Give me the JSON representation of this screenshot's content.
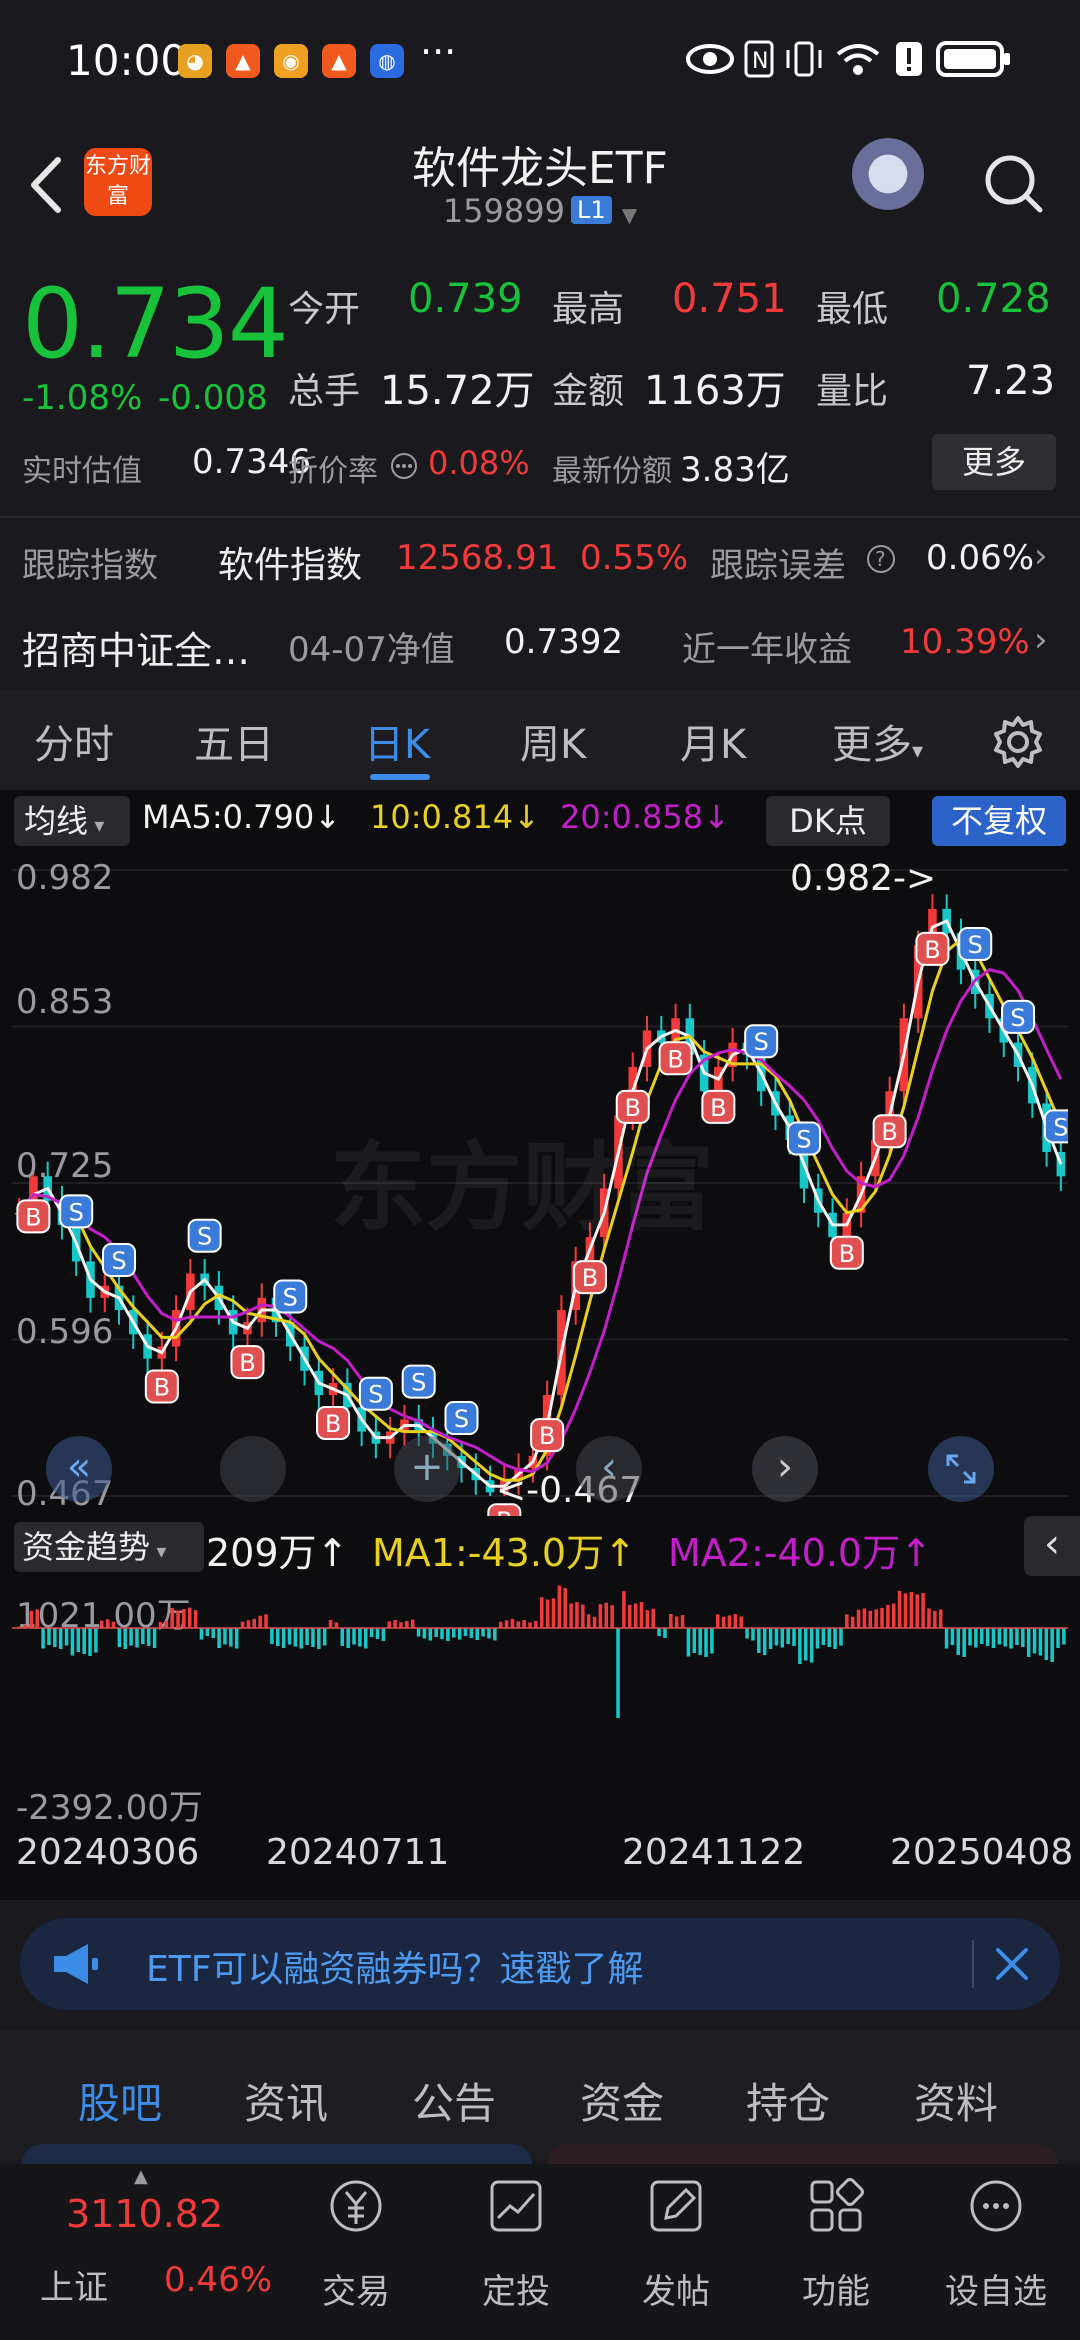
{
  "status_bar": {
    "time": "10:00",
    "more": "···"
  },
  "header": {
    "logo_text": "东方财富",
    "title": "软件龙头ETF",
    "code": "159899",
    "code_badge": "L1"
  },
  "quote": {
    "price": "0.734",
    "change_pct": "-1.08%",
    "change_abs": "-0.008",
    "open_label": "今开",
    "open": "0.739",
    "high_label": "最高",
    "high": "0.751",
    "low_label": "最低",
    "low": "0.728",
    "volume_label": "总手",
    "volume": "15.72万",
    "amount_label": "金额",
    "amount": "1163万",
    "ratio_label": "量比",
    "ratio": "7.23",
    "iopv_label": "实时估值",
    "iopv": "0.7346",
    "discount_label": "折价率",
    "discount": "0.08%",
    "shares_label": "最新份额",
    "shares": "3.83亿",
    "more_button": "更多"
  },
  "tracking": {
    "index_label": "跟踪指数",
    "index_name": "软件指数",
    "index_value": "12568.91",
    "index_change": "0.55%",
    "error_label": "跟踪误差",
    "error_value": "0.06%",
    "fund_name": "招商中证全…",
    "nav_label": "04-07净值",
    "nav_value": "0.7392",
    "year_return_label": "近一年收益",
    "year_return": "10.39%"
  },
  "tabs": [
    "分时",
    "五日",
    "日K",
    "周K",
    "月K",
    "更多"
  ],
  "active_tab": 2,
  "chart_controls": {
    "ma_selector": "均线",
    "ma5": "MA5:0.790",
    "ma10": "10:0.814",
    "ma20": "20:0.858",
    "dk_button": "DK点",
    "adjust_button": "不复权",
    "watermark": "东方财富",
    "colors": {
      "ma5": "#f2f2f2",
      "ma10": "#e8d020",
      "ma20": "#c21fc8",
      "up": "#f23a3a",
      "down": "#18c8c8"
    }
  },
  "chart_data": {
    "type": "candlestick",
    "ylim": [
      0.467,
      0.982
    ],
    "yticks": [
      "0.982",
      "0.853",
      "0.725",
      "0.596",
      "0.467"
    ],
    "max_label": "0.982->",
    "min_label": "<-0.467",
    "x_dates": [
      "20240306",
      "20240711",
      "20241122",
      "20250408"
    ],
    "close_series": [
      0.7,
      0.73,
      0.71,
      0.69,
      0.66,
      0.63,
      0.64,
      0.62,
      0.6,
      0.58,
      0.59,
      0.62,
      0.65,
      0.64,
      0.62,
      0.6,
      0.61,
      0.63,
      0.61,
      0.59,
      0.57,
      0.55,
      0.56,
      0.54,
      0.52,
      0.51,
      0.52,
      0.53,
      0.52,
      0.51,
      0.5,
      0.49,
      0.48,
      0.47,
      0.48,
      0.49,
      0.5,
      0.55,
      0.62,
      0.66,
      0.68,
      0.72,
      0.78,
      0.82,
      0.85,
      0.84,
      0.86,
      0.83,
      0.8,
      0.82,
      0.84,
      0.83,
      0.8,
      0.78,
      0.76,
      0.72,
      0.7,
      0.68,
      0.7,
      0.73,
      0.76,
      0.8,
      0.86,
      0.92,
      0.95,
      0.93,
      0.9,
      0.88,
      0.86,
      0.84,
      0.82,
      0.79,
      0.75,
      0.73
    ]
  },
  "fund_flow": {
    "selector": "资金趋势",
    "value": "209万",
    "ma1": "MA1:-43.0万",
    "ma2": "MA2:-40.0万",
    "y_top": "1021.00万",
    "y_bottom": "-2392.00万"
  },
  "banner": {
    "text": "ETF可以融资融券吗？速戳了解"
  },
  "content_tabs": [
    "股吧",
    "资讯",
    "公告",
    "资金",
    "持仓",
    "资料"
  ],
  "bottom_nav": {
    "index_value": "3110.82",
    "index_name": "上证",
    "index_change": "0.46%",
    "items": [
      "交易",
      "定投",
      "发帖",
      "功能",
      "设自选"
    ]
  }
}
